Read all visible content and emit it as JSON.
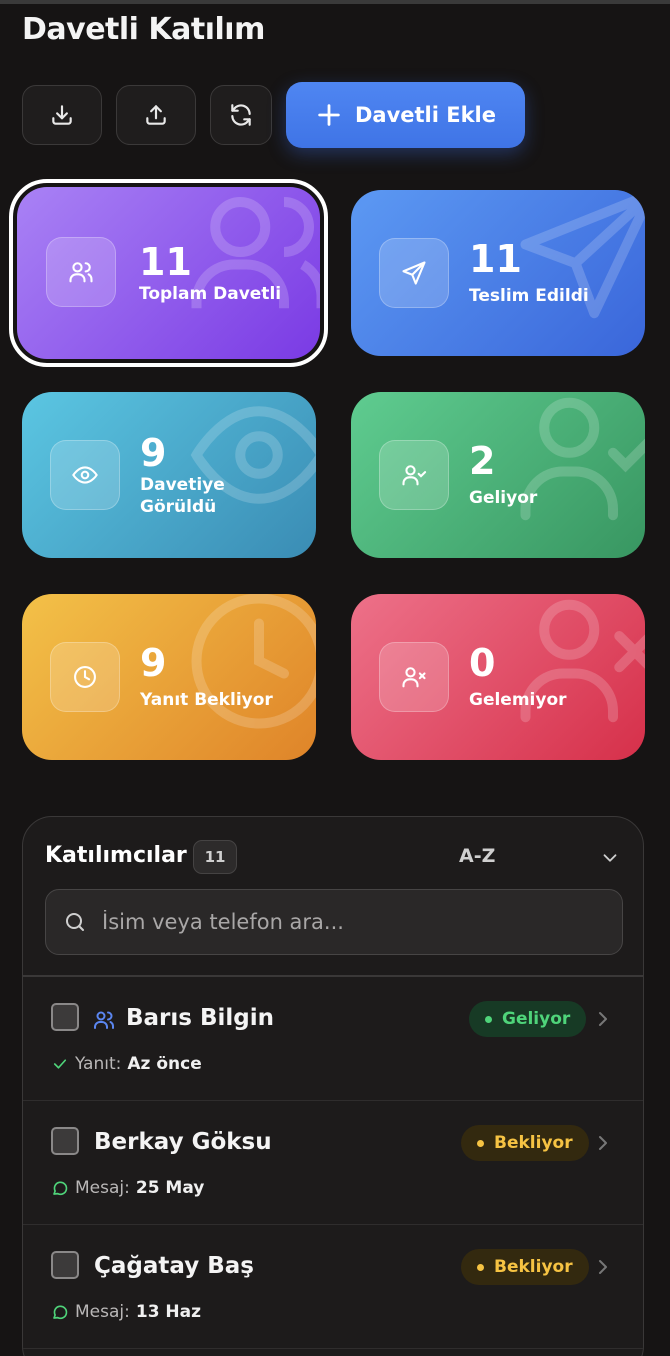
{
  "header": {
    "title": "Davetli Katılım"
  },
  "toolbar": {
    "download_icon": "download-icon",
    "upload_icon": "upload-icon",
    "refresh_icon": "refresh-icon",
    "add_label": "Davetli Ekle"
  },
  "stats": [
    {
      "value": "11",
      "label": "Toplam Davetli",
      "icon": "users-icon",
      "colors": [
        "#a57cf3",
        "#7434e0"
      ],
      "selected": true
    },
    {
      "value": "11",
      "label": "Teslim Edildi",
      "icon": "send-icon",
      "colors": [
        "#5b97f2",
        "#3b6bdc"
      ]
    },
    {
      "value": "9",
      "label": "Davetiye Görüldü",
      "icon": "eye-icon",
      "colors": [
        "#5ac2df",
        "#3a8fb6"
      ]
    },
    {
      "value": "2",
      "label": "Geliyor",
      "icon": "user-check-icon",
      "colors": [
        "#5fcb8f",
        "#3a9a64"
      ]
    },
    {
      "value": "9",
      "label": "Yanıt Bekliyor",
      "icon": "clock-icon",
      "colors": [
        "#f2be46",
        "#e0862a"
      ]
    },
    {
      "value": "0",
      "label": "Gelemiyor",
      "icon": "user-x-icon",
      "colors": [
        "#ec6f86",
        "#d9334c"
      ]
    }
  ],
  "participants": {
    "title": "Katılımcılar",
    "count": "11",
    "sort": "A-Z",
    "search_placeholder": "İsim veya telefon ara...",
    "items": [
      {
        "name": "Barıs Bilgin",
        "group": true,
        "status": "Geliyor",
        "status_color": "#4fd47a",
        "sub_label": "Yanıt:",
        "sub_value": "Az önce",
        "sub_icon": "check-icon"
      },
      {
        "name": "Berkay Göksu",
        "group": false,
        "status": "Bekliyor",
        "status_color": "#f6c343",
        "sub_label": "Mesaj:",
        "sub_value": "25 May",
        "sub_icon": "message-icon"
      },
      {
        "name": "Çağatay Baş",
        "group": false,
        "status": "Bekliyor",
        "status_color": "#f6c343",
        "sub_label": "Mesaj:",
        "sub_value": "13 Haz",
        "sub_icon": "message-icon"
      }
    ]
  }
}
